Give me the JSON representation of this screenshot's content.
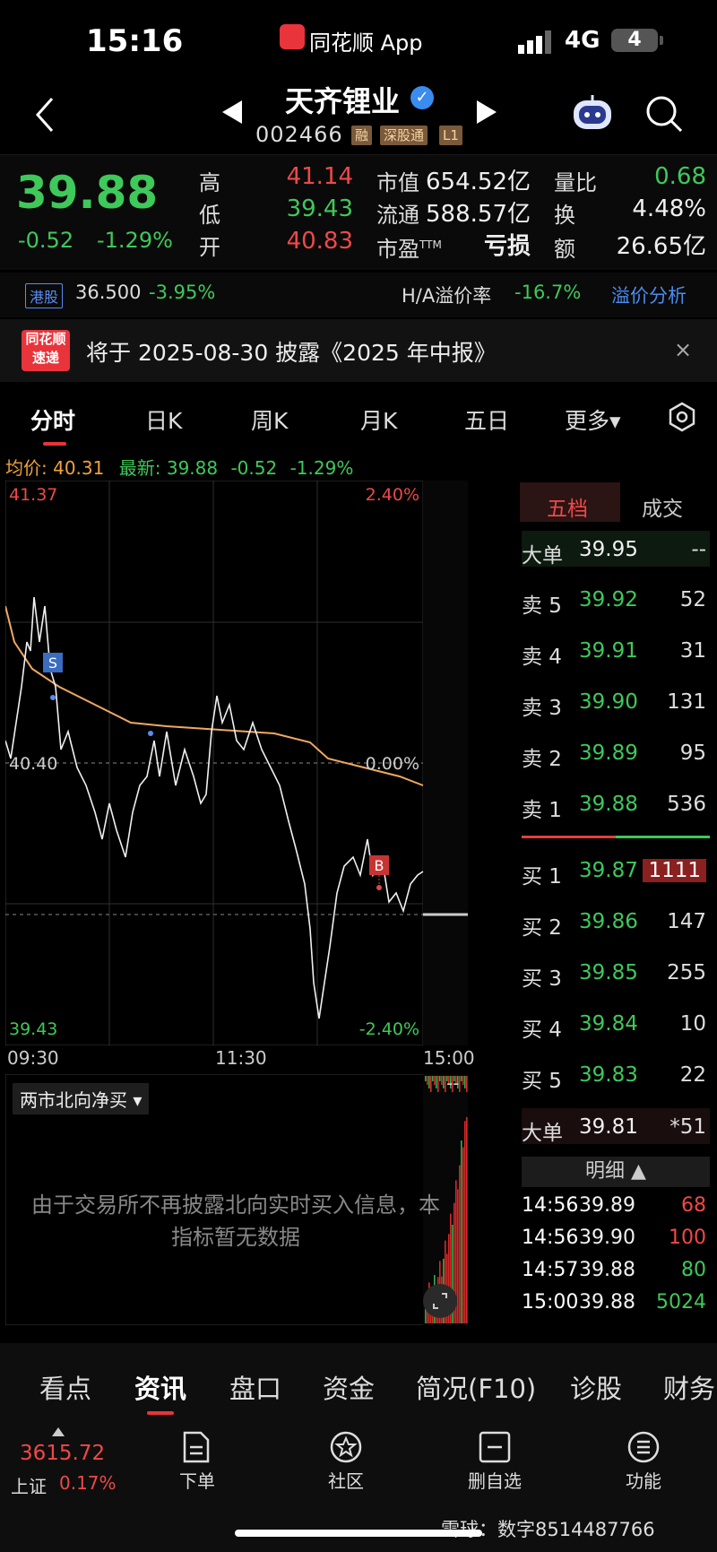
{
  "status_bar": {
    "time": "15:16",
    "app_name": "同花顺 App",
    "network": "4G",
    "battery": "4"
  },
  "header": {
    "stock_name": "天齐锂业",
    "stock_code": "002466",
    "tags": [
      "融",
      "深股通",
      "L1"
    ]
  },
  "quote": {
    "last_price": "39.88",
    "change": "-0.52",
    "change_pct": "-1.29%",
    "high_label": "高",
    "high": "41.14",
    "low_label": "低",
    "low": "39.43",
    "open_label": "开",
    "open": "40.83",
    "mcap_label": "市值",
    "mcap": "654.52亿",
    "float_label": "流通",
    "float": "588.57亿",
    "pe_label": "市盈",
    "pe_sup": "TTM",
    "pe": "亏损",
    "vr_label": "量比",
    "vr": "0.68",
    "turnover_label": "换",
    "turnover": "4.48%",
    "amount_label": "额",
    "amount": "26.65亿"
  },
  "hk": {
    "tag": "港股",
    "price": "36.500",
    "change": "-3.95%",
    "ha_label": "H/A溢价率",
    "ha_value": "-16.7%",
    "link": "溢价分析"
  },
  "news": {
    "logo_line1": "同花顺",
    "logo_line2": "速递",
    "text": "将于 2025-08-30 披露《2025 年中报》",
    "close": "×"
  },
  "chart_tabs": [
    "分时",
    "日K",
    "周K",
    "月K",
    "五日",
    "更多▾"
  ],
  "avg_row": {
    "avg_label": "均价:",
    "avg": "40.31",
    "latest_label": "最新:",
    "latest": "39.88",
    "chg": "-0.52",
    "pct": "-1.29%"
  },
  "chart": {
    "y_top": "41.37",
    "y_mid": "40.40",
    "y_bottom": "39.43",
    "pct_top": "2.40%",
    "pct_mid": "0.00%",
    "pct_bottom": "-2.40%",
    "t_start": "09:30",
    "t_mid": "11:30",
    "t_end": "15:00",
    "marker_sell": "S",
    "marker_buy": "B"
  },
  "north": {
    "selector": "两市北向净买 ▾",
    "dash": "--",
    "message_line1": "由于交易所不再披露北向实时买入信息，本",
    "message_line2": "指标暂无数据"
  },
  "orderbook": {
    "tabs": [
      "五档",
      "成交"
    ],
    "big_top": {
      "label": "大单",
      "price": "39.95",
      "vol": "--"
    },
    "asks": [
      {
        "label": "卖 5",
        "price": "39.92",
        "vol": "52"
      },
      {
        "label": "卖 4",
        "price": "39.91",
        "vol": "31"
      },
      {
        "label": "卖 3",
        "price": "39.90",
        "vol": "131"
      },
      {
        "label": "卖 2",
        "price": "39.89",
        "vol": "95"
      },
      {
        "label": "卖 1",
        "price": "39.88",
        "vol": "536"
      }
    ],
    "bids": [
      {
        "label": "买 1",
        "price": "39.87",
        "vol": "1111"
      },
      {
        "label": "买 2",
        "price": "39.86",
        "vol": "147"
      },
      {
        "label": "买 3",
        "price": "39.85",
        "vol": "255"
      },
      {
        "label": "买 4",
        "price": "39.84",
        "vol": "10"
      },
      {
        "label": "买 5",
        "price": "39.83",
        "vol": "22"
      }
    ],
    "big_bottom": {
      "label": "大单",
      "price": "39.81",
      "vol": "*51"
    },
    "detail_label": "明细 ▲",
    "ticks": [
      {
        "time": "14:56",
        "price": "39.89",
        "vol": "68"
      },
      {
        "time": "14:56",
        "price": "39.90",
        "vol": "100"
      },
      {
        "time": "14:57",
        "price": "39.88",
        "vol": "80"
      },
      {
        "time": "15:00",
        "price": "39.88",
        "vol": "5024"
      }
    ]
  },
  "sub_tabs": [
    "看点",
    "资讯",
    "盘口",
    "资金",
    "简况(F10)",
    "诊股",
    "财务"
  ],
  "nav": {
    "index_value": "3615.72",
    "index_name": "上证",
    "index_pct": "0.17%",
    "items": [
      "下单",
      "社区",
      "删自选",
      "功能"
    ],
    "watermark": "雪球：数字8514487766"
  },
  "colors": {
    "up": "#f04848",
    "down": "#3ec95a",
    "avg_line": "#f0a860",
    "accent": "#e8343a"
  }
}
